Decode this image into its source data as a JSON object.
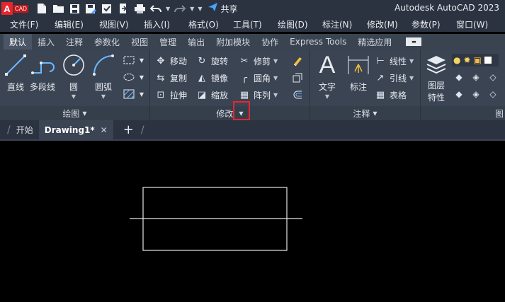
{
  "app": {
    "title": "Autodesk AutoCAD 2023",
    "logo_letter": "A",
    "logo_sub": "CAD",
    "share_label": "共享"
  },
  "menubar": [
    "文件(F)",
    "编辑(E)",
    "视图(V)",
    "插入(I)",
    "格式(O)",
    "工具(T)",
    "绘图(D)",
    "标注(N)",
    "修改(M)",
    "参数(P)",
    "窗口(W)"
  ],
  "ribbon_tabs": [
    "默认",
    "插入",
    "注释",
    "参数化",
    "视图",
    "管理",
    "输出",
    "附加模块",
    "协作",
    "Express Tools",
    "精选应用"
  ],
  "panels": {
    "draw": {
      "title": "绘图",
      "line": "直线",
      "polyline": "多段线",
      "circle": "圆",
      "arc": "圆弧"
    },
    "modify": {
      "title": "修改",
      "move": "移动",
      "rotate": "旋转",
      "trim": "修剪",
      "copy": "复制",
      "mirror": "镜像",
      "fillet": "圆角",
      "stretch": "拉伸",
      "scale": "缩放",
      "array": "阵列"
    },
    "annotation": {
      "title": "注释",
      "text": "文字",
      "dimension": "标注",
      "linear": "线性",
      "leader": "引线",
      "table": "表格"
    },
    "layers": {
      "properties_line1": "图层",
      "properties_line2": "特性",
      "title_partial": "图"
    }
  },
  "file_tabs": {
    "start": "开始",
    "drawing": "Drawing1*"
  },
  "colors": {
    "accent_red": "#e6262e",
    "ribbon_bg": "#3b4453",
    "canvas_bg": "#000000"
  }
}
